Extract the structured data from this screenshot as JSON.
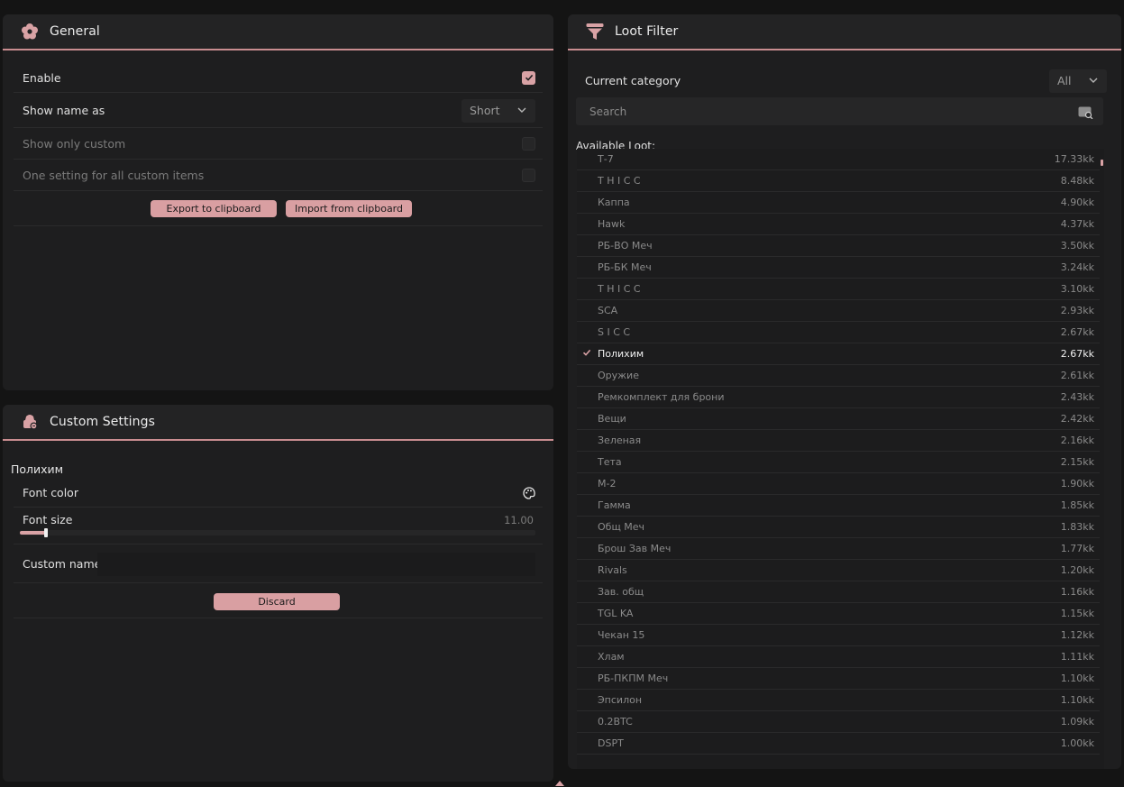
{
  "general": {
    "title": "General",
    "rows": {
      "enable": {
        "label": "Enable",
        "checked": true
      },
      "show_name_as": {
        "label": "Show name as",
        "value": "Short"
      },
      "show_only_custom": {
        "label": "Show only custom",
        "checked": false
      },
      "one_setting": {
        "label": "One setting for all custom items",
        "checked": false
      }
    },
    "export_label": "Export to clipboard",
    "import_label": "Import from clipboard"
  },
  "custom": {
    "title": "Custom Settings",
    "item_name": "Полихим",
    "font_color_label": "Font color",
    "font_size_label": "Font size",
    "font_size_value": "11.00",
    "font_size_fraction": 0.05,
    "custom_name_label": "Custom name",
    "discard_label": "Discard"
  },
  "loot": {
    "title": "Loot Filter",
    "category_label": "Current category",
    "category_value": "All",
    "search_placeholder": "Search",
    "available_label": "Available Loot:",
    "items": [
      {
        "name": "Т-7",
        "value": "17.33kk"
      },
      {
        "name": "T H I C C",
        "value": "8.48kk"
      },
      {
        "name": "Каппа",
        "value": "4.90kk"
      },
      {
        "name": "Hawk",
        "value": "4.37kk"
      },
      {
        "name": "РБ-ВО Меч",
        "value": "3.50kk"
      },
      {
        "name": "РБ-БК Меч",
        "value": "3.24kk"
      },
      {
        "name": "T H I C C",
        "value": "3.10kk"
      },
      {
        "name": "SCA",
        "value": "2.93kk"
      },
      {
        "name": "S I C C",
        "value": "2.67kk"
      },
      {
        "name": "Полихим",
        "value": "2.67kk",
        "selected": true
      },
      {
        "name": "Оружие",
        "value": "2.61kk"
      },
      {
        "name": "Ремкомплект для брони",
        "value": "2.43kk"
      },
      {
        "name": "Вещи",
        "value": "2.42kk"
      },
      {
        "name": "Зеленая",
        "value": "2.16kk"
      },
      {
        "name": "Тета",
        "value": "2.15kk"
      },
      {
        "name": "M-2",
        "value": "1.90kk"
      },
      {
        "name": "Гамма",
        "value": "1.85kk"
      },
      {
        "name": "Общ Меч",
        "value": "1.83kk"
      },
      {
        "name": "Брош Зав Меч",
        "value": "1.77kk"
      },
      {
        "name": "Rivals",
        "value": "1.20kk"
      },
      {
        "name": "Зав. общ",
        "value": "1.16kk"
      },
      {
        "name": "TGL KA",
        "value": "1.15kk"
      },
      {
        "name": "Чекан 15",
        "value": "1.12kk"
      },
      {
        "name": "Хлам",
        "value": "1.11kk"
      },
      {
        "name": "РБ-ПКПМ Меч",
        "value": "1.10kk"
      },
      {
        "name": "Эпсилон",
        "value": "1.10kk"
      },
      {
        "name": "0.2BTC",
        "value": "1.09kk"
      },
      {
        "name": "DSPT",
        "value": "1.00kk"
      }
    ]
  },
  "colors": {
    "accent": "#d9a2a5",
    "panel": "#1e1e1f",
    "background": "#141414"
  }
}
